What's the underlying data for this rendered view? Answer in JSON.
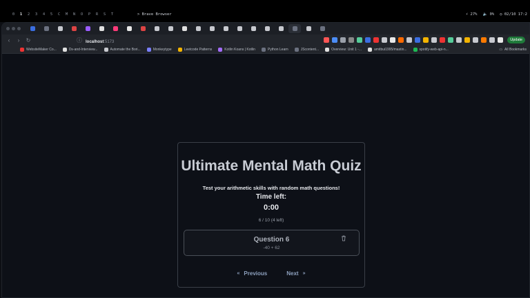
{
  "system": {
    "workspaces": [
      "0",
      "1",
      "2",
      "3",
      "4",
      "5",
      "C",
      "M",
      "N",
      "O",
      "P",
      "R",
      "S",
      "T"
    ],
    "active_workspace": "1",
    "window_title": "> Brave Browser",
    "battery": "27%",
    "volume": "0%",
    "datetime": "02/10 17:2"
  },
  "browser": {
    "url_host": "localhost",
    "url_port": ":5173",
    "update_label": "Update",
    "bookmarks": [
      "WebsiteMaker Co...",
      "Ds-and-Interview...",
      "Automate the Bori...",
      "Monkeytype",
      "Leetcode Patterns",
      "Kotlin Koans | Kotlin",
      "Python Learn",
      "JScontent...",
      "Overview: Unit 1 -...",
      "amitbui1995/mastin...",
      "spotify-web-api-n..."
    ],
    "all_bookmarks_label": "All Bookmarks"
  },
  "quiz": {
    "title": "Ultimate Mental Math Quiz",
    "subtitle": "Test your arithmetic skills with random math questions!",
    "time_label": "Time left:",
    "time_value": "0:00",
    "progress": "6 / 10 (4 left)",
    "question_title": "Question 6",
    "question_expr": "-40 + 62",
    "prev_label": "Previous",
    "next_label": "Next"
  },
  "colors": {
    "page_bg": "#0d1017",
    "card_border": "#3a3f48",
    "title": "#c8ccd4",
    "nav_link": "#8ea1bf"
  }
}
